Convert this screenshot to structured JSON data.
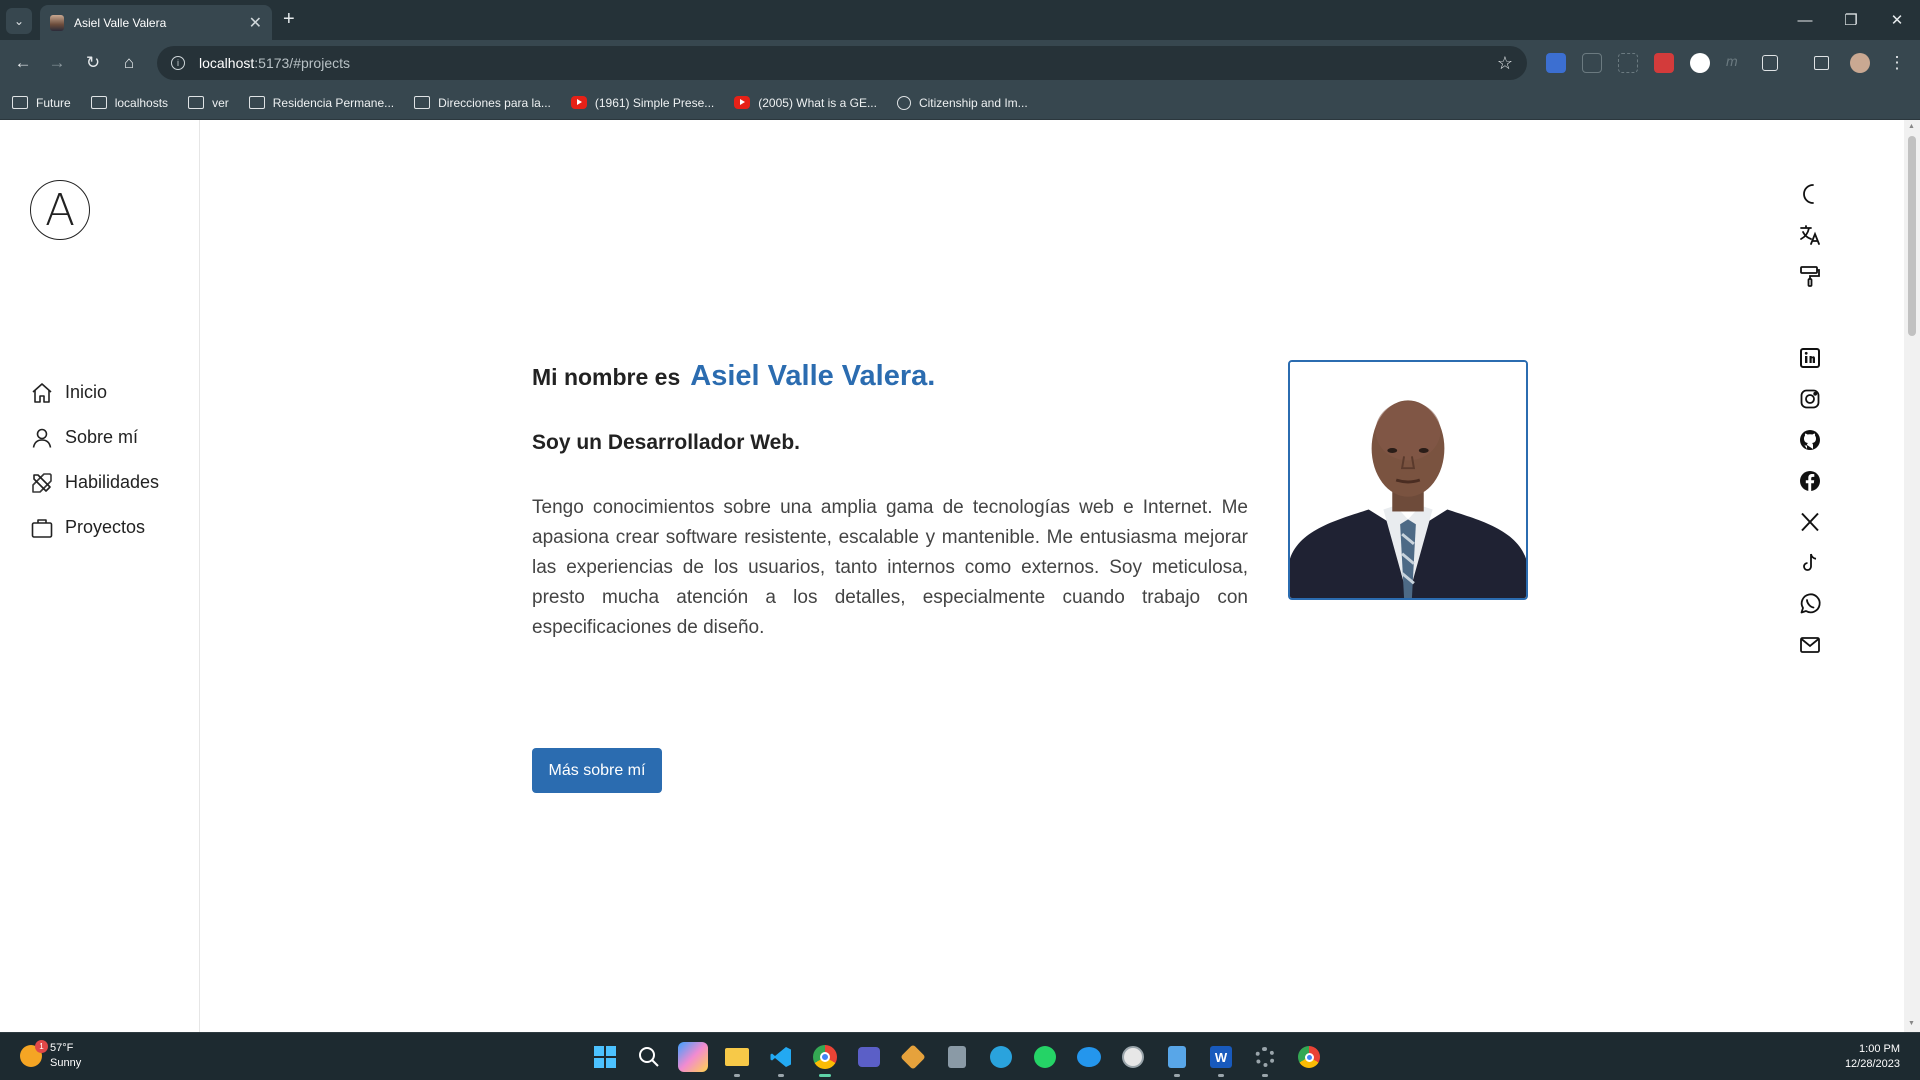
{
  "browser": {
    "tab_title": "Asiel Valle Valera",
    "url_host": "localhost",
    "url_path": ":5173/#projects",
    "bookmarks": [
      {
        "label": "Future",
        "icon": "folder-icon"
      },
      {
        "label": "localhosts",
        "icon": "folder-icon"
      },
      {
        "label": "ver",
        "icon": "folder-icon"
      },
      {
        "label": "Residencia Permane...",
        "icon": "gov-icon"
      },
      {
        "label": "Direcciones para la...",
        "icon": "gov-icon"
      },
      {
        "label": "(1961) Simple Prese...",
        "icon": "youtube-icon"
      },
      {
        "label": "(2005) What is a GE...",
        "icon": "youtube-icon"
      },
      {
        "label": "Citizenship and Im...",
        "icon": "uscis-icon"
      }
    ]
  },
  "sidebar": {
    "logo_letter": "A",
    "items": [
      {
        "label": "Inicio",
        "icon": "home-icon"
      },
      {
        "label": "Sobre mí",
        "icon": "user-icon"
      },
      {
        "label": "Habilidades",
        "icon": "tools-icon"
      },
      {
        "label": "Proyectos",
        "icon": "briefcase-icon"
      }
    ]
  },
  "hero": {
    "greeting": "Mi nombre es",
    "name": "Asiel Valle Valera.",
    "role": "Soy un Desarrollador Web.",
    "bio": "Tengo conocimientos sobre una amplia gama de tecnologías web e Internet. Me apasiona crear software resistente, escalable y mantenible. Me entusiasma mejorar las experiencias de los usuarios, tanto internos como externos. Soy meticulosa, presto mucha atención a los detalles, especialmente cuando trabajo con especificaciones de diseño.",
    "cta_label": "Más sobre mí",
    "accent_color": "#2b6cb0"
  },
  "right_icons": [
    "moon-icon",
    "translate-icon",
    "paint-roller-icon",
    "linkedin-icon",
    "instagram-icon",
    "github-icon",
    "facebook-icon",
    "x-icon",
    "tiktok-icon",
    "whatsapp-icon",
    "mail-icon"
  ],
  "taskbar": {
    "temperature": "57°F",
    "condition": "Sunny",
    "notification_count": "1",
    "time": "1:00 PM",
    "date": "12/28/2023"
  }
}
